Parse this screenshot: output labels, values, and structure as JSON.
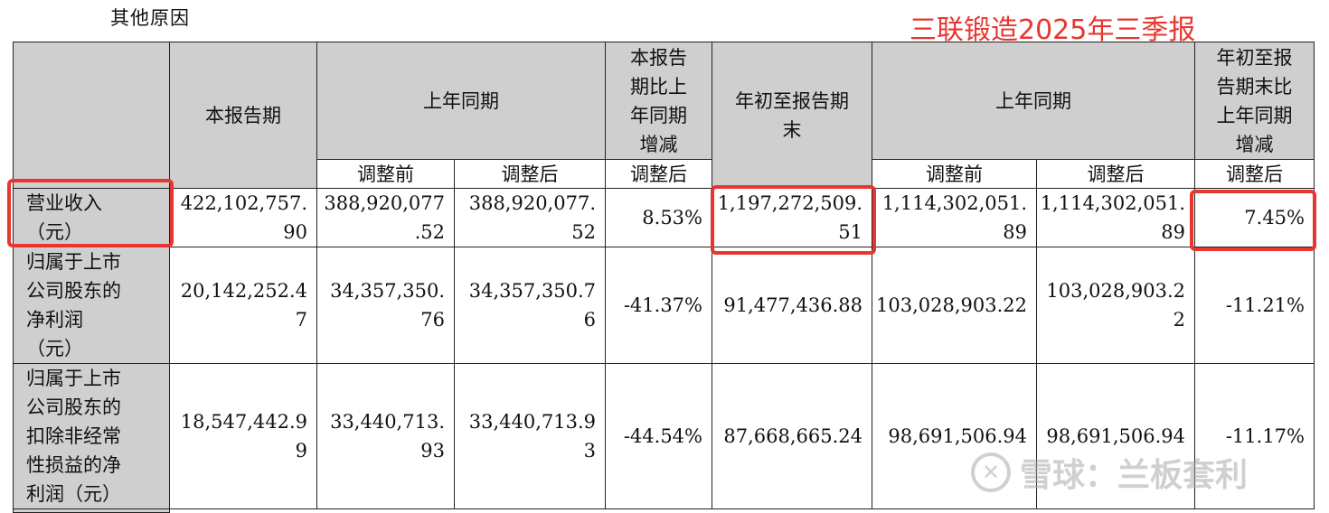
{
  "top_label": "其他原因",
  "title": "三联锻造2025年三季报",
  "headers": {
    "current_period": "本报告期",
    "prior_year_same_period": "上年同期",
    "current_vs_prior_change": "本报告\n期比上\n年同期\n增减",
    "ytd_end": "年初至报告期\n末",
    "prior_year_same_period_2": "上年同期",
    "ytd_vs_prior_change": "年初至报\n告期末比\n上年同期\n增减",
    "before_adjustment": "调整前",
    "after_adjustment": "调整后",
    "after_adjustment_2": "调整后",
    "before_adjustment_2": "调整前",
    "after_adjustment_3": "调整后",
    "after_adjustment_4": "调整后"
  },
  "rows": [
    {
      "label": "营业收入\n（元）",
      "current": "422,102,757.\n90",
      "prior_before": "388,920,077\n.52",
      "prior_after": "388,920,077.\n52",
      "change": "8.53%",
      "ytd": "1,197,272,509.\n51",
      "ytd_prior_before": "1,114,302,051.\n89",
      "ytd_prior_after": "1,114,302,051.\n89",
      "ytd_change": "7.45%"
    },
    {
      "label": "归属于上市\n公司股东的\n净利润\n（元）",
      "current": "20,142,252.4\n7",
      "prior_before": "34,357,350.\n76",
      "prior_after": "34,357,350.7\n6",
      "change": "-41.37%",
      "ytd": "91,477,436.88",
      "ytd_prior_before": "103,028,903.22",
      "ytd_prior_after": "103,028,903.2\n2",
      "ytd_change": "-11.21%"
    },
    {
      "label": "归属于上市\n公司股东的\n扣除非经常\n性损益的净\n利润（元）",
      "current": "18,547,442.9\n9",
      "prior_before": "33,440,713.\n93",
      "prior_after": "33,440,713.9\n3",
      "change": "-44.54%",
      "ytd": "87,668,665.24",
      "ytd_prior_before": "98,691,506.94",
      "ytd_prior_after": "98,691,506.94",
      "ytd_change": "-11.17%"
    }
  ],
  "watermark": "雪球：兰板套利",
  "colors": {
    "highlight": "#e8362f",
    "header_fill": "#cfcfcf"
  }
}
